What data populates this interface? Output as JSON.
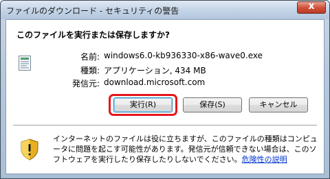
{
  "window": {
    "title": "ファイルのダウンロード - セキュリティの警告",
    "close_glyph": "x"
  },
  "prompt": "このファイルを実行または保存しますか?",
  "file": {
    "icon": "executable-file-icon",
    "name_label": "名前:",
    "name_value": "windows6.0-kb936330-x86-wave0.exe",
    "type_label": "種類:",
    "type_value": "アプリケーション, 434 MB",
    "source_label": "発信元:",
    "source_value": "download.microsoft.com"
  },
  "buttons": {
    "run": "実行(R)",
    "save": "保存(S)",
    "cancel": "キャンセル"
  },
  "highlight_color": "#e8141b",
  "warning": {
    "icon": "security-shield-icon",
    "text": "インターネットのファイルは役に立ちますが、このファイルの種類はコンピュータに問題を起こす可能性があります。発信元が信頼できない場合は、このソフトウェアを実行したり保存したりしないでください。",
    "link": "危険性の説明"
  }
}
